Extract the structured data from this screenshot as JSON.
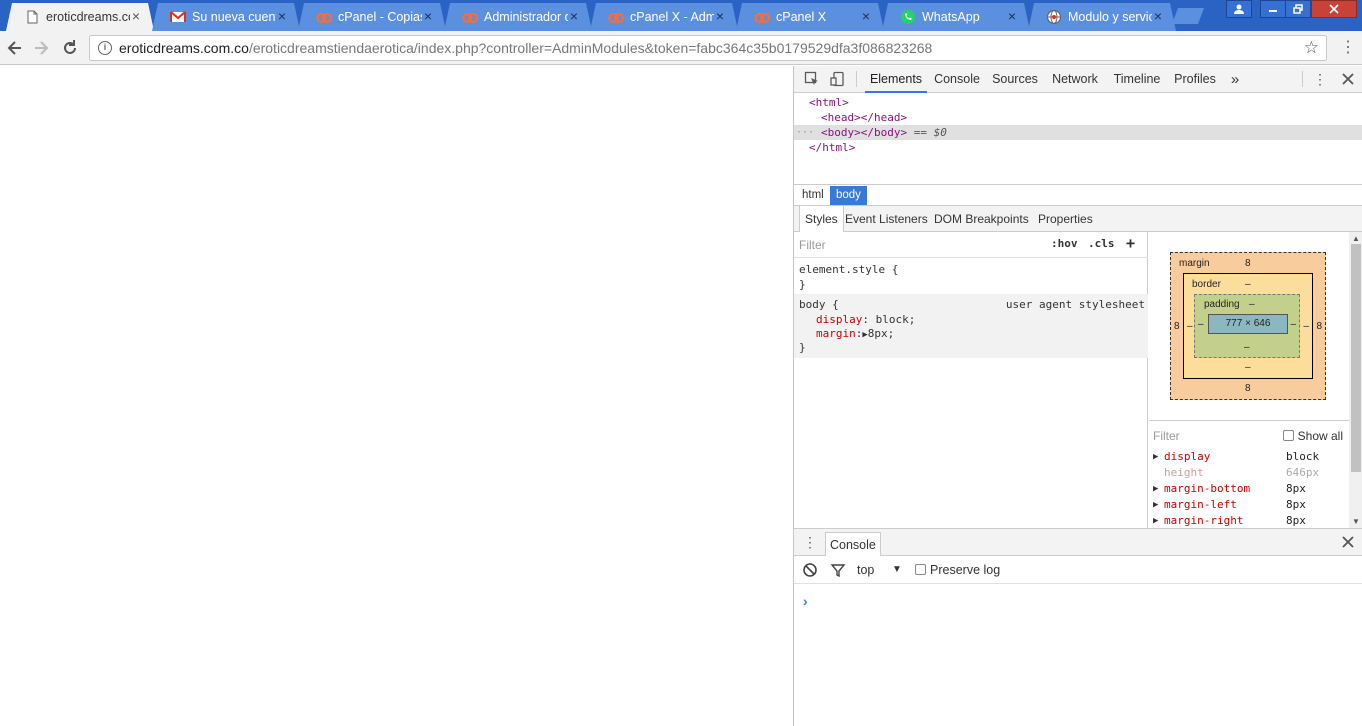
{
  "tabs": [
    {
      "title": "eroticdreams.co",
      "icon": "page-icon",
      "active": true
    },
    {
      "title": "Su nueva cuenta",
      "icon": "gmail-icon",
      "active": false
    },
    {
      "title": "cPanel - Copias",
      "icon": "cpanel-icon",
      "active": false
    },
    {
      "title": "Administrador d",
      "icon": "cpanel-icon",
      "active": false
    },
    {
      "title": "cPanel X - Adm",
      "icon": "cpanel-icon",
      "active": false
    },
    {
      "title": "cPanel X",
      "icon": "cpanel-icon",
      "active": false
    },
    {
      "title": "WhatsApp",
      "icon": "whatsapp-icon",
      "active": false
    },
    {
      "title": "Modulo y servic",
      "icon": "globe-icon",
      "active": false
    }
  ],
  "toolbar": {
    "url_host": "eroticdreams.com.co",
    "url_path": "/eroticdreamstiendaerotica/index.php?controller=AdminModules&token=fabc364c35b0179529dfa3f086823268"
  },
  "devtools": {
    "tabs": [
      "Elements",
      "Console",
      "Sources",
      "Network",
      "Timeline",
      "Profiles"
    ],
    "more": "»",
    "dom": {
      "html_open": "<html>",
      "head": "<head></head>",
      "body": "<body></body>",
      "body_ref": "== $0",
      "html_close": "</html>",
      "ellipsis": "···"
    },
    "breadcrumbs": [
      "html",
      "body"
    ],
    "subtabs": [
      "Styles",
      "Event Listeners",
      "DOM Breakpoints",
      "Properties"
    ],
    "styles": {
      "filter_placeholder": "Filter",
      "hov": ":hov",
      "cls": ".cls",
      "add": "+",
      "element_style_open": "element.style {",
      "close_brace": "}",
      "body_selector": "body {",
      "origin": "user agent stylesheet",
      "decl1_prop": "display",
      "decl1_value": "block;",
      "decl2_prop": "margin",
      "decl2_value": "8px;"
    },
    "box_model": {
      "margin_label": "margin",
      "margin": "8",
      "border_label": "border",
      "padding_label": "padding",
      "dash": "–",
      "content": "777 × 646"
    },
    "computed": {
      "filter_placeholder": "Filter",
      "show_all": "Show all",
      "rows": [
        {
          "prop": "display",
          "value": "block",
          "inherited": false
        },
        {
          "prop": "height",
          "value": "646px",
          "inherited": true
        },
        {
          "prop": "margin-bottom",
          "value": "8px",
          "inherited": false
        },
        {
          "prop": "margin-left",
          "value": "8px",
          "inherited": false
        },
        {
          "prop": "margin-right",
          "value": "8px",
          "inherited": false
        }
      ]
    },
    "drawer": {
      "tab": "Console",
      "context": "top",
      "preserve_log": "Preserve log",
      "prompt": "›"
    }
  },
  "colors": {
    "tabstrip": "#2b63c4",
    "accent": "#3879d9",
    "css_property": "#c80000",
    "tag": "#881280"
  }
}
